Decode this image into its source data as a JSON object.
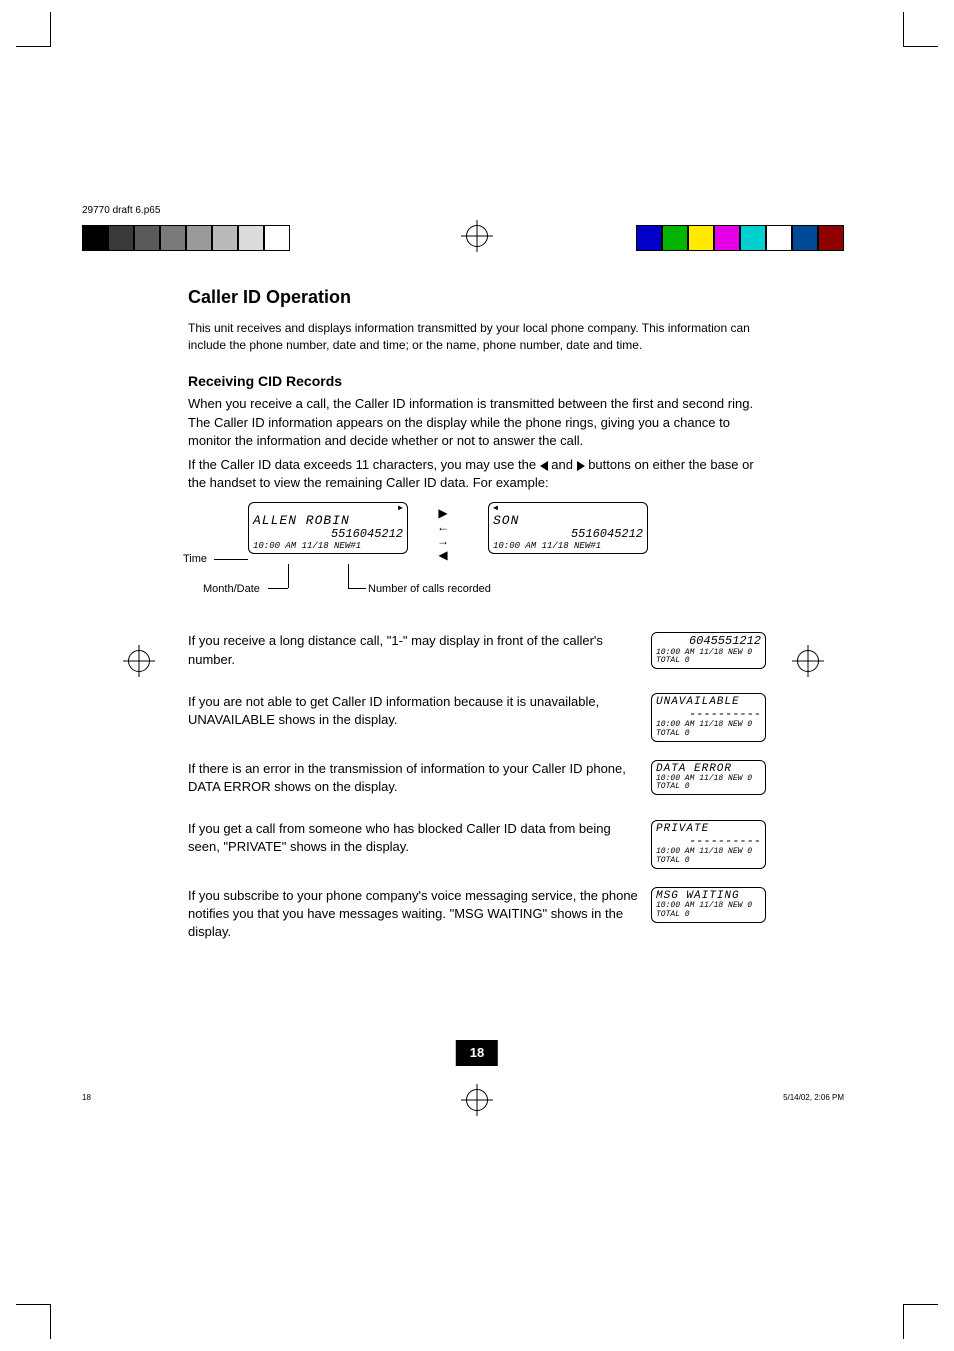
{
  "header_file": "29770 draft 6.p65",
  "heading": "Caller ID Operation",
  "intro_small": "This unit receives and displays information transmitted by your local phone company. This information can include the phone number, date and time; or the name, phone number, date and time.",
  "feature1_title": "Receiving CID Records",
  "feature1_body1": "When you receive a call, the Caller ID information is transmitted between the first and second ring. The Caller ID information appears on the display while the phone rings, giving you a chance to monitor the information and decide whether or not to answer the call.",
  "feature1_body2_pre": "If the Caller ID data exceeds 11 characters, you may use the ",
  "feature1_body2_mid": " and ",
  "feature1_body2_post": " buttons on either the base or the handset to view the remaining Caller ID data. For example:",
  "diagram": {
    "left": {
      "name": "ALLEN ROBIN",
      "num": "5516045212",
      "status": "10:00 AM 11/18 NEW#1"
    },
    "right": {
      "name": "SON",
      "num": "5516045212",
      "status": "10:00 AM 11/18 NEW#1"
    },
    "label_time": "Time",
    "label_date": "Month/Date",
    "label_count": "Number of calls recorded"
  },
  "items": [
    {
      "text": "If you receive a long distance call, \"1-\" may display in front of the caller's number.",
      "lcd": {
        "l1": "",
        "l2": "6045551212",
        "l3": "10:00 AM 11/18 NEW 0  TOTAL 0"
      }
    },
    {
      "text": "If you are not able to get Caller ID information because it is unavailable, UNAVAILABLE shows in the display.",
      "lcd": {
        "l1": "UNAVAILABLE",
        "l2": "----------",
        "l3": "10:00 AM 11/18 NEW 0  TOTAL 0"
      }
    },
    {
      "text": "If there is an error in the transmission of information to your Caller ID phone, DATA ERROR shows on the display.",
      "lcd": {
        "l1": "DATA ERROR",
        "l2": "",
        "l3": "10:00 AM 11/18 NEW 0  TOTAL 0"
      }
    },
    {
      "text": "If you get a call from someone who has blocked Caller ID data from being seen, \"PRIVATE\" shows in the display.",
      "lcd": {
        "l1": "PRIVATE",
        "l2": "----------",
        "l3": "10:00 AM 11/18 NEW 0  TOTAL 0"
      }
    },
    {
      "text": "If you subscribe to your phone company's voice messaging service, the phone notifies you that you have messages waiting. \"MSG WAITING\" shows in the display.",
      "lcd": {
        "l1": "MSG WAITING",
        "l2": "",
        "l3": "10:00 AM 11/18 NEW 0  TOTAL 0"
      }
    }
  ],
  "page_num": "18",
  "footer_page": "18",
  "footer_date": "5/14/02, 2:06 PM",
  "colors_left": [
    "#000",
    "#3a3a3a",
    "#5a5a5a",
    "#7a7a7a",
    "#9a9a9a",
    "#bababa",
    "#dcdcdc",
    "#fff"
  ],
  "colors_right": [
    "#0000c8",
    "#00b400",
    "#ffea00",
    "#e600e6",
    "#00d0d0",
    "#ffffff",
    "#004a9a",
    "#8e0000"
  ]
}
